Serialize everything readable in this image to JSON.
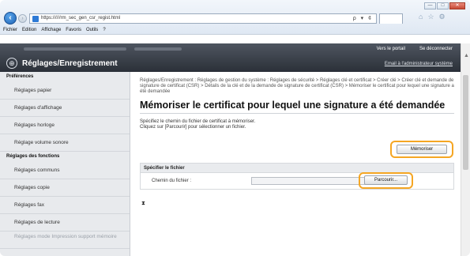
{
  "browser": {
    "url": "https://////rm_sec_gen_csr_regist.html",
    "addr_tools": "ρ ▾ ¢",
    "window_controls": {
      "minimize": "—",
      "maximize": "□",
      "close": "✕"
    },
    "menu": [
      "Fichier",
      "Edition",
      "Affichage",
      "Favoris",
      "Outils",
      "?"
    ]
  },
  "header": {
    "logo_glyph": "⊕",
    "title": "Réglages/Enregistrement",
    "portal_link": "Vers le portail",
    "logout_link": "Se déconnecter",
    "admin_mail_link": "Email à l'administrateur système"
  },
  "sidebar": {
    "sections": [
      {
        "title": "Préférences",
        "items": [
          "Réglages papier",
          "Réglages d'affichage",
          "Réglages horloge",
          "Réglage volume sonore"
        ]
      },
      {
        "title": "Réglages des fonctions",
        "items": [
          "Réglages communs",
          "Réglages copie",
          "Réglages fax",
          "Réglages de lecture"
        ]
      }
    ],
    "partial_item": "Réglages mode Impression support mémoire"
  },
  "main": {
    "breadcrumb": "Réglages/Enregistrement : Réglages de gestion du système : Réglages de sécurité > Réglages clé et certificat > Créer clé > Créer clé et demande de signature de certificat (CSR) > Détails de la clé et de la demande de signature de certificat (CSR) > Mémoriser le certificat pour lequel une signature a été demandée",
    "title": "Mémoriser le certificat pour lequel une signature a été demandée",
    "instruction_line1": "Spécifiez le chemin du fichier de certificat à mémoriser.",
    "instruction_line2": "Cliquez sur [Parcourir] pour sélectionner un fichier.",
    "memorize_button": "Mémoriser",
    "panel_title": "Spécifier le fichier",
    "file_path_label": "Chemin du fichier :",
    "browse_button": "Parcourir...",
    "to_top_glyph": "⧗"
  },
  "colors": {
    "highlight": "#f5a623",
    "header_bg": "#2b3038",
    "sidebar_bg": "#e8eaed"
  }
}
